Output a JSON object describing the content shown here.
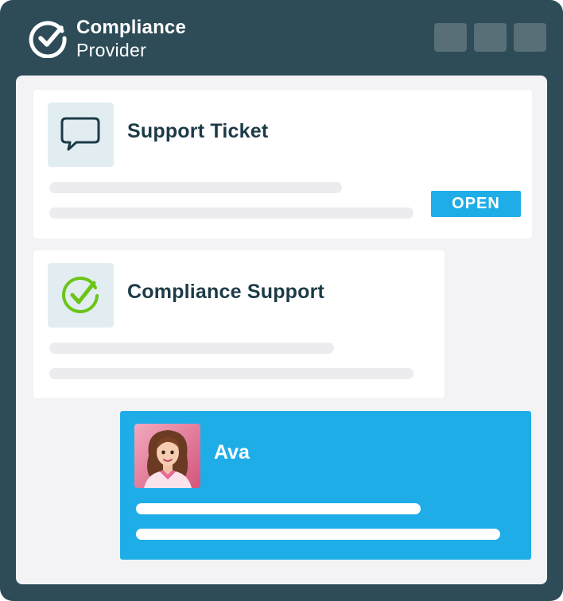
{
  "brand": {
    "name": "Compliance",
    "subtitle": "Provider",
    "logo_icon": "check-circle-icon"
  },
  "window_controls": [
    "minimize-button",
    "maximize-button",
    "close-button"
  ],
  "ticket_card": {
    "icon": "chat-bubble-icon",
    "title": "Support Ticket",
    "status": "OPEN"
  },
  "compliance_card": {
    "icon": "check-circle-icon",
    "title": "Compliance Support"
  },
  "agent_card": {
    "avatar": "agent-avatar",
    "name": "Ava"
  },
  "colors": {
    "frame": "#2d4c57",
    "content_bg": "#f3f3f5",
    "accent_blue": "#1fade8",
    "title_text": "#1c3b47",
    "check_green": "#6cc417",
    "icon_tile": "#e2edf2"
  }
}
